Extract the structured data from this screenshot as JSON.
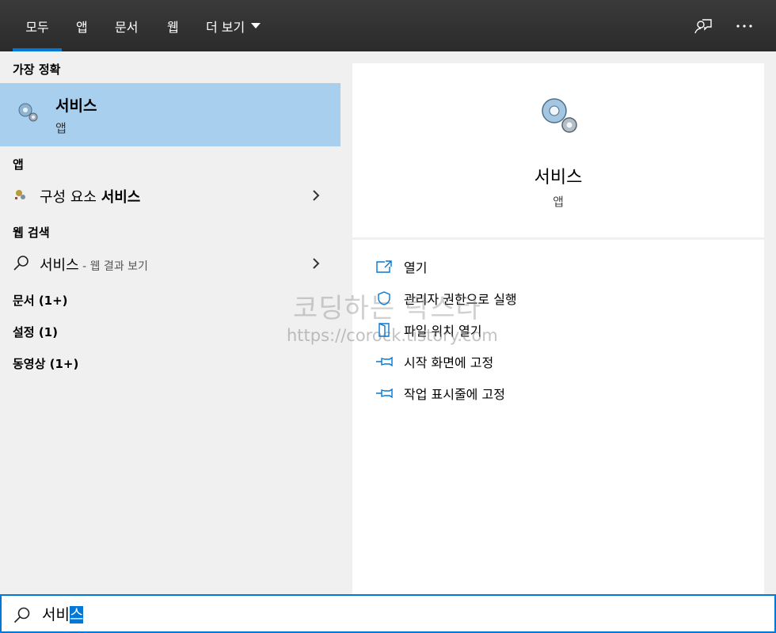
{
  "tabs": [
    {
      "label": "모두",
      "active": true
    },
    {
      "label": "앱",
      "active": false
    },
    {
      "label": "문서",
      "active": false
    },
    {
      "label": "웹",
      "active": false
    },
    {
      "label": "더 보기",
      "active": false
    }
  ],
  "left": {
    "best_match_heading": "가장 정확",
    "best_match": {
      "title": "서비스",
      "subtitle": "앱",
      "icon": "gears-icon"
    },
    "apps_heading": "앱",
    "app_item": {
      "prefix": "구성 요소 ",
      "bold": "서비스",
      "icon": "component-services-icon"
    },
    "web_heading": "웹 검색",
    "web_item": {
      "text": "서비스",
      "sub": " - 웹 결과 보기",
      "icon": "search-icon"
    },
    "categories": [
      "문서 (1+)",
      "설정 (1)",
      "동영상 (1+)"
    ]
  },
  "right": {
    "title": "서비스",
    "subtitle": "앱",
    "actions": [
      {
        "label": "열기",
        "icon": "open-icon"
      },
      {
        "label": "관리자 권한으로 실행",
        "icon": "shield-icon"
      },
      {
        "label": "파일 위치 열기",
        "icon": "file-location-icon"
      },
      {
        "label": "시작 화면에 고정",
        "icon": "pin-icon"
      },
      {
        "label": "작업 표시줄에 고정",
        "icon": "pin-icon"
      }
    ]
  },
  "watermark": {
    "line1": "코딩하는 락스타",
    "line2": "https://corock.tistory.com"
  },
  "search": {
    "prefix": "서비",
    "selected": "스"
  },
  "colors": {
    "accent": "#0078d7",
    "selection": "#a9cfee",
    "topbar": "#2b2b2b"
  }
}
